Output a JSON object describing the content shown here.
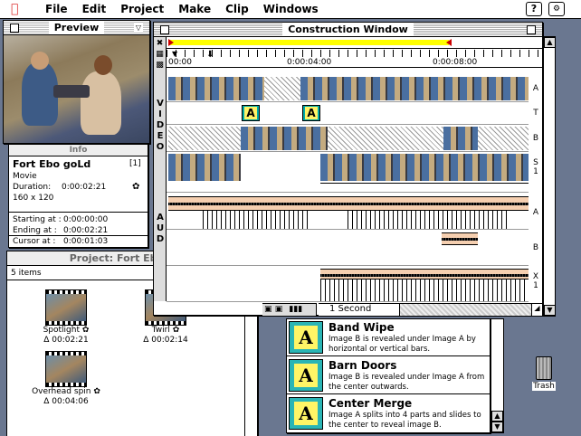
{
  "menubar": {
    "items": [
      "File",
      "Edit",
      "Project",
      "Make",
      "Clip",
      "Windows"
    ],
    "help_icon": "?"
  },
  "preview": {
    "title": "Preview"
  },
  "info": {
    "title": "Info",
    "clip_name": "Fort Ebo goLd",
    "clip_index": "[1]",
    "type": "Movie",
    "duration_label": "Duration:",
    "duration": "0:00:02:21",
    "size": "160 x 120",
    "starting_label": "Starting at :",
    "starting": "0:00:00:00",
    "ending_label": "Ending at :",
    "ending": "0:00:02:21",
    "cursor_label": "Cursor at :",
    "cursor": "0:00:01:03"
  },
  "project": {
    "title": "Project: Fort Ebo goLd",
    "items_count": "5 items",
    "clips": [
      {
        "name": "Spotlight",
        "duration": "Δ 00:02:21"
      },
      {
        "name": "Twirl",
        "duration": "Δ 00:02:14"
      },
      {
        "name": "Overhead spin",
        "duration": "Δ 00:04:06"
      }
    ]
  },
  "construction": {
    "title": "Construction Window",
    "time_labels": [
      "00:00",
      "0:00:04:00",
      "0:00:08:00"
    ],
    "side_video": [
      "V",
      "I",
      "D",
      "E",
      "O"
    ],
    "side_audio": [
      "A",
      "U",
      "D"
    ],
    "track_labels": [
      "A",
      "T",
      "B",
      "S 1",
      "A",
      "B",
      "X 1"
    ],
    "transition_letter": "A",
    "time_unit": "1 Second"
  },
  "effects": [
    {
      "name": "Band Wipe",
      "desc": "Image B is revealed under Image A by horizontal or vertical bars.",
      "icon": "A"
    },
    {
      "name": "Barn Doors",
      "desc": "Image B is revealed under Image A from the center outwards.",
      "icon": "A"
    },
    {
      "name": "Center Merge",
      "desc": "Image A splits into 4 parts and slides to the center to reveal image B.",
      "icon": "A"
    }
  ],
  "trash": {
    "label": "Trash"
  }
}
